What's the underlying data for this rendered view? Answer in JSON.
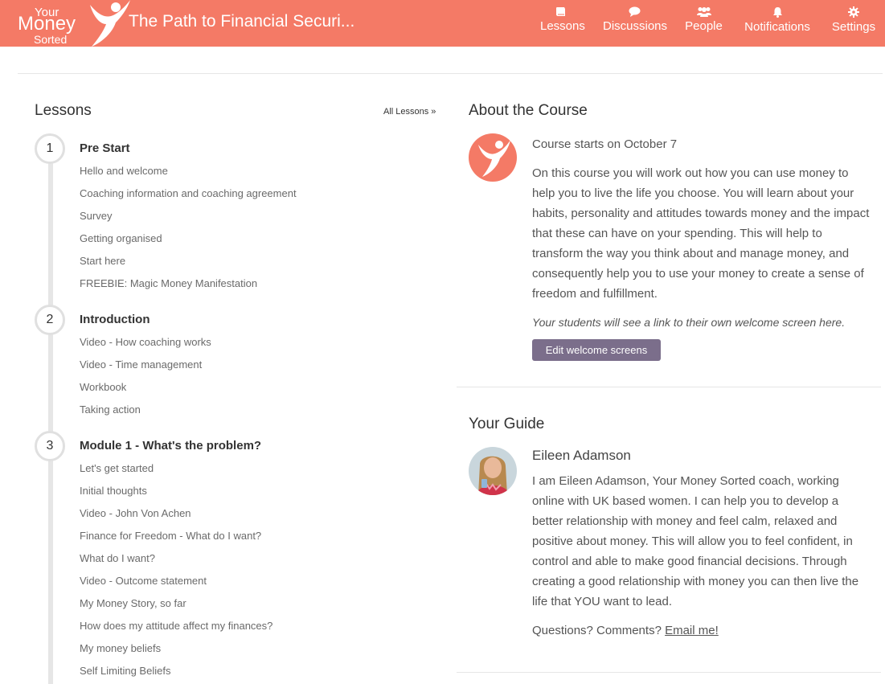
{
  "header": {
    "logo": {
      "line1": "Your",
      "line2": "Money",
      "line3": "Sorted"
    },
    "course_title": "The Path to Financial Securi...",
    "nav": [
      {
        "label": "Lessons",
        "icon": "book-icon"
      },
      {
        "label": "Discussions",
        "icon": "speech-bubble-icon"
      },
      {
        "label": "People",
        "icon": "people-icon"
      },
      {
        "label": "Notifications",
        "icon": "bell-icon"
      },
      {
        "label": "Settings",
        "icon": "gear-icon"
      }
    ],
    "accent_color": "#f47a66"
  },
  "lessons": {
    "heading": "Lessons",
    "all_lessons_link": "All Lessons »",
    "sections": [
      {
        "number": "1",
        "title": "Pre Start",
        "items": [
          "Hello and welcome",
          "Coaching information and coaching agreement",
          "Survey",
          "Getting organised",
          "Start here",
          "FREEBIE: Magic Money Manifestation"
        ]
      },
      {
        "number": "2",
        "title": "Introduction",
        "items": [
          "Video - How coaching works",
          "Video - Time management",
          "Workbook",
          "Taking action"
        ]
      },
      {
        "number": "3",
        "title": "Module 1 - What's the problem?",
        "items": [
          "Let's get started",
          "Initial thoughts",
          "Video - John Von Achen",
          "Finance for Freedom - What do I want?",
          "What do I want?",
          "Video - Outcome statement",
          "My Money Story, so far",
          "How does my attitude affect my finances?",
          "My money beliefs",
          "Self Limiting Beliefs"
        ]
      }
    ]
  },
  "about": {
    "heading": "About the Course",
    "starts": "Course starts on October 7",
    "description": "On this course you will work out how you can use money to help you to live the life you choose. You will learn about your habits, personality and attitudes towards money and the impact that these can have on your spending. This will help to transform the way you think about and manage money, and consequently help you to use your money to create a sense of freedom and fulfillment.",
    "note": "Your students will see a link to their own welcome screen here.",
    "edit_button": "Edit welcome screens",
    "button_color": "#7b6e8b"
  },
  "guide": {
    "heading": "Your Guide",
    "name": "Eileen Adamson",
    "bio": "I am Eileen Adamson, Your Money Sorted coach, working online with UK based women. I can help you to develop a better relationship with money and feel calm, relaxed and positive about money. This will allow you to feel confident, in control and able to make good financial decisions. Through creating a good relationship with money you can then live the life that YOU want to lead.",
    "questions_text": "Questions? Comments?",
    "email_link": "Email me!"
  }
}
